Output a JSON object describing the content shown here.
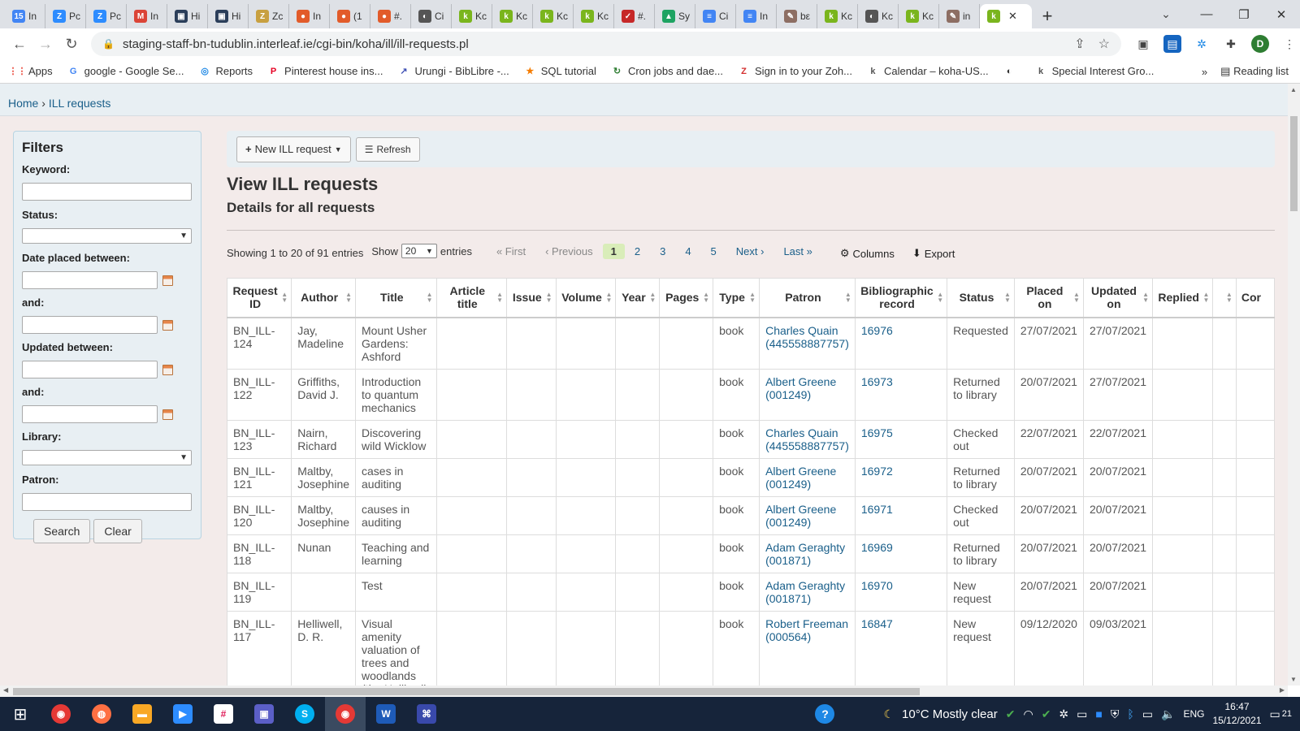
{
  "browser": {
    "tabs": [
      {
        "label": "In",
        "fav": "15",
        "color": "#4285f4"
      },
      {
        "label": "Pc",
        "fav": "Z",
        "color": "#2d8cff"
      },
      {
        "label": "Pc",
        "fav": "Z",
        "color": "#2d8cff"
      },
      {
        "label": "In",
        "fav": "M",
        "color": "#db4437"
      },
      {
        "label": "Hi",
        "fav": "▣",
        "color": "#2b3e5a"
      },
      {
        "label": "Hi",
        "fav": "▣",
        "color": "#2b3e5a"
      },
      {
        "label": "Zc",
        "fav": "Z",
        "color": "#c8a040"
      },
      {
        "label": "In",
        "fav": "●",
        "color": "#e25b2a"
      },
      {
        "label": "(1",
        "fav": "●",
        "color": "#e25b2a"
      },
      {
        "label": "#.",
        "fav": "●",
        "color": "#e25b2a"
      },
      {
        "label": "Ci",
        "fav": "◐",
        "color": "#555555"
      },
      {
        "label": "Kc",
        "fav": "k",
        "color": "#7ab51d"
      },
      {
        "label": "Kc",
        "fav": "k",
        "color": "#7ab51d"
      },
      {
        "label": "Kc",
        "fav": "k",
        "color": "#7ab51d"
      },
      {
        "label": "Kc",
        "fav": "k",
        "color": "#7ab51d"
      },
      {
        "label": "#.",
        "fav": "✓",
        "color": "#c62828"
      },
      {
        "label": "Sy",
        "fav": "▲",
        "color": "#1ea362"
      },
      {
        "label": "Ci",
        "fav": "≡",
        "color": "#4285f4"
      },
      {
        "label": "In",
        "fav": "≡",
        "color": "#4285f4"
      },
      {
        "label": "bε",
        "fav": "✎",
        "color": "#8d6e63"
      },
      {
        "label": "Kc",
        "fav": "k",
        "color": "#7ab51d"
      },
      {
        "label": "Kc",
        "fav": "◐",
        "color": "#555555"
      },
      {
        "label": "Kc",
        "fav": "k",
        "color": "#7ab51d"
      },
      {
        "label": "in",
        "fav": "✎",
        "color": "#8d6e63"
      }
    ],
    "active_tab_fav": "k",
    "url": "staging-staff-bn-tudublin.interleaf.ie/cgi-bin/koha/ill/ill-requests.pl",
    "profile_initial": "D",
    "bookmarks": [
      {
        "label": "Apps",
        "icon": "⋮⋮",
        "color": "#ea4335"
      },
      {
        "label": "google - Google Se...",
        "icon": "G",
        "color": "#4285f4"
      },
      {
        "label": "Reports",
        "icon": "◎",
        "color": "#1e88e5"
      },
      {
        "label": "Pinterest house ins...",
        "icon": "P",
        "color": "#e60023"
      },
      {
        "label": "Urungi - BibLibre -...",
        "icon": "↗",
        "color": "#3f51b5"
      },
      {
        "label": "SQL tutorial",
        "icon": "★",
        "color": "#f57c00"
      },
      {
        "label": "Cron jobs and dae...",
        "icon": "↻",
        "color": "#2e7d32"
      },
      {
        "label": "Sign in to your Zoh...",
        "icon": "Z",
        "color": "#d32f2f"
      },
      {
        "label": "Calendar – koha-US...",
        "icon": "k",
        "color": "#555555"
      },
      {
        "label": "",
        "icon": "◐",
        "color": "#333333"
      },
      {
        "label": "Special Interest Gro...",
        "icon": "k",
        "color": "#555555"
      }
    ],
    "reading_list": "Reading list"
  },
  "breadcrumb": {
    "home": "Home",
    "sep": " › ",
    "current": "ILL requests"
  },
  "filters": {
    "title": "Filters",
    "keyword_label": "Keyword:",
    "status_label": "Status:",
    "placed_label": "Date placed between:",
    "and1_label": "and:",
    "updated_label": "Updated between:",
    "and2_label": "and:",
    "library_label": "Library:",
    "patron_label": "Patron:",
    "search_btn": "Search",
    "clear_btn": "Clear"
  },
  "toolbar": {
    "new_request": "New ILL request",
    "refresh": "Refresh"
  },
  "heading": {
    "title": "View ILL requests",
    "subtitle": "Details for all requests"
  },
  "paging": {
    "info": "Showing 1 to 20 of 91 entries",
    "show": "Show",
    "entries_value": "20",
    "entries": "entries",
    "first": "« First",
    "previous": "‹ Previous",
    "pages": [
      "1",
      "2",
      "3",
      "4",
      "5"
    ],
    "next": "Next ›",
    "last": "Last »",
    "columns": "Columns",
    "export": "Export"
  },
  "table": {
    "headers": [
      "Request ID",
      "Author",
      "Title",
      "Article title",
      "Issue",
      "Volume",
      "Year",
      "Pages",
      "Type",
      "Patron",
      "Bibliographic record",
      "Status",
      "Placed on",
      "Updated on",
      "Replied",
      "",
      "Cor"
    ],
    "rows": [
      {
        "id": "BN_ILL-124",
        "author": "Jay, Madeline",
        "title": "Mount Usher Gardens: Ashford",
        "type": "book",
        "patron": "Charles Quain (445558887757)",
        "biblio": "16976",
        "status": "Requested",
        "placed": "27/07/2021",
        "updated": "27/07/2021"
      },
      {
        "id": "BN_ILL-122",
        "author": "Griffiths, David J.",
        "title": "Introduction to quantum mechanics",
        "type": "book",
        "patron": "Albert Greene (001249)",
        "biblio": "16973",
        "status": "Returned to library",
        "placed": "20/07/2021",
        "updated": "27/07/2021"
      },
      {
        "id": "BN_ILL-123",
        "author": "Nairn, Richard",
        "title": "Discovering wild Wicklow",
        "type": "book",
        "patron": "Charles Quain (445558887757)",
        "biblio": "16975",
        "status": "Checked out",
        "placed": "22/07/2021",
        "updated": "22/07/2021"
      },
      {
        "id": "BN_ILL-121",
        "author": "Maltby, Josephine",
        "title": "cases in auditing",
        "type": "book",
        "patron": "Albert Greene (001249)",
        "biblio": "16972",
        "status": "Returned to library",
        "placed": "20/07/2021",
        "updated": "20/07/2021"
      },
      {
        "id": "BN_ILL-120",
        "author": "Maltby, Josephine",
        "title": "causes in auditing",
        "type": "book",
        "patron": "Albert Greene (001249)",
        "biblio": "16971",
        "status": "Checked out",
        "placed": "20/07/2021",
        "updated": "20/07/2021"
      },
      {
        "id": "BN_ILL-118",
        "author": "Nunan",
        "title": "Teaching and learning",
        "type": "book",
        "patron": "Adam Geraghty (001871)",
        "biblio": "16969",
        "status": "Returned to library",
        "placed": "20/07/2021",
        "updated": "20/07/2021"
      },
      {
        "id": "BN_ILL-119",
        "author": "",
        "title": "Test",
        "type": "book",
        "patron": "Adam Geraghty (001871)",
        "biblio": "16970",
        "status": "New request",
        "placed": "20/07/2021",
        "updated": "20/07/2021"
      },
      {
        "id": "BN_ILL-117",
        "author": "Helliwell, D. R.",
        "title": "Visual amenity valuation of trees and woodlands (the Helliwell",
        "type": "book",
        "patron": "Robert Freeman (000564)",
        "biblio": "16847",
        "status": "New request",
        "placed": "09/12/2020",
        "updated": "09/03/2021"
      }
    ]
  },
  "taskbar": {
    "weather": "10°C  Mostly clear",
    "lang": "ENG",
    "time": "16:47",
    "date": "15/12/2021",
    "notif": "21"
  }
}
